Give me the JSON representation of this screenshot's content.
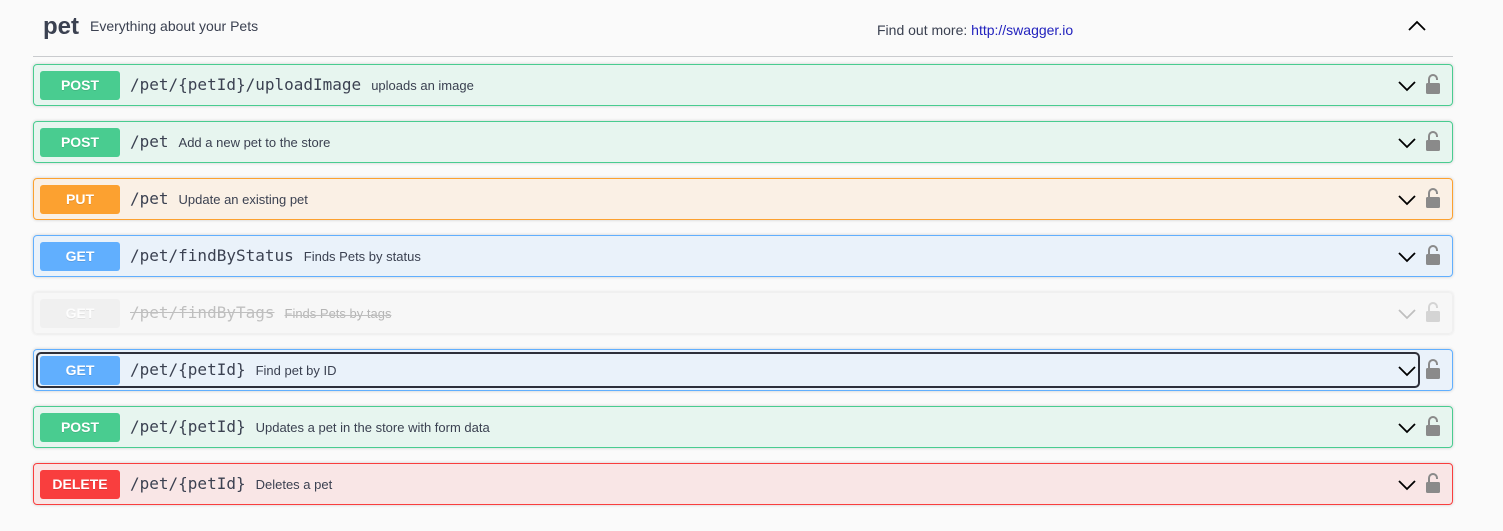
{
  "tag": {
    "name": "pet",
    "description": "Everything about your Pets",
    "find_more_label": "Find out more:",
    "find_more_link": "http://swagger.io",
    "collapse_icon": "chevron-up-icon"
  },
  "colors": {
    "post": "#49cc90",
    "put": "#fca130",
    "get": "#61affe",
    "delete": "#f93e3e",
    "deprecated": "#ebebeb",
    "link": "#1f1fbd"
  },
  "operations": [
    {
      "method": "POST",
      "path": "/pet/{petId}/uploadImage",
      "summary": "uploads an image",
      "type": "post",
      "deprecated": false,
      "focused": false
    },
    {
      "method": "POST",
      "path": "/pet",
      "summary": "Add a new pet to the store",
      "type": "post",
      "deprecated": false,
      "focused": false
    },
    {
      "method": "PUT",
      "path": "/pet",
      "summary": "Update an existing pet",
      "type": "put",
      "deprecated": false,
      "focused": false
    },
    {
      "method": "GET",
      "path": "/pet/findByStatus",
      "summary": "Finds Pets by status",
      "type": "get",
      "deprecated": false,
      "focused": false
    },
    {
      "method": "GET",
      "path": "/pet/findByTags",
      "summary": "Finds Pets by tags",
      "type": "deprecated",
      "deprecated": true,
      "focused": false
    },
    {
      "method": "GET",
      "path": "/pet/{petId}",
      "summary": "Find pet by ID",
      "type": "get",
      "deprecated": false,
      "focused": true
    },
    {
      "method": "POST",
      "path": "/pet/{petId}",
      "summary": "Updates a pet in the store with form data",
      "type": "post",
      "deprecated": false,
      "focused": false
    },
    {
      "method": "DELETE",
      "path": "/pet/{petId}",
      "summary": "Deletes a pet",
      "type": "delete",
      "deprecated": false,
      "focused": false
    }
  ]
}
